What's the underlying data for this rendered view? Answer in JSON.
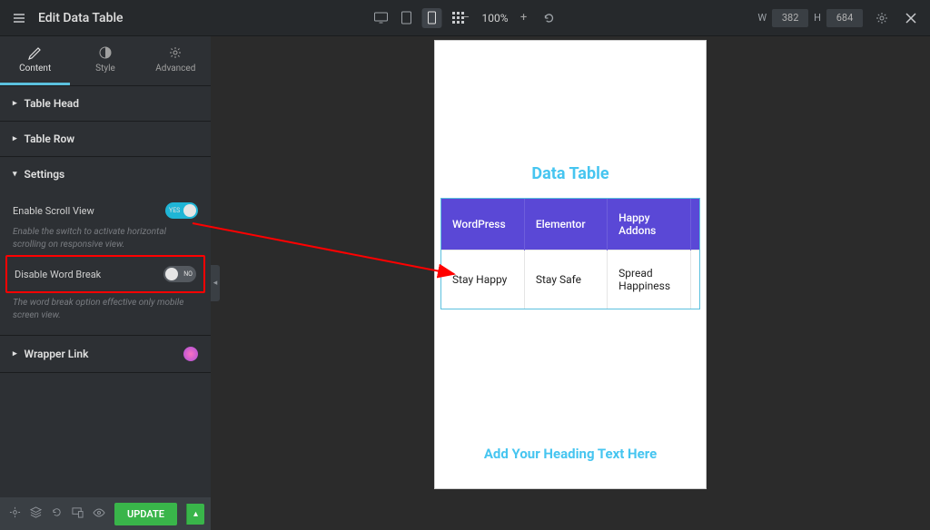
{
  "topbar": {
    "title": "Edit Data Table",
    "zoom": "100%",
    "width_label": "W",
    "width_value": "382",
    "height_label": "H",
    "height_value": "684"
  },
  "tabs": {
    "content": "Content",
    "style": "Style",
    "advanced": "Advanced"
  },
  "panels": {
    "table_head": "Table Head",
    "table_row": "Table Row",
    "settings": "Settings",
    "wrapper_link": "Wrapper Link"
  },
  "settings": {
    "scroll_label": "Enable Scroll View",
    "scroll_desc": "Enable the switch to activate horizontal scrolling on responsive view.",
    "scroll_yes": "YES",
    "wordbreak_label": "Disable Word Break",
    "wordbreak_desc": "The word break option effective only mobile screen view.",
    "wordbreak_no": "NO"
  },
  "footer": {
    "update": "UPDATE"
  },
  "preview": {
    "widget_title": "Data Table",
    "heading_placeholder": "Add Your Heading Text Here",
    "headers": [
      "WordPress",
      "Elementor",
      "Happy Addons"
    ],
    "rows": [
      [
        "Stay Happy",
        "Stay Safe",
        "Spread Happiness"
      ]
    ]
  }
}
